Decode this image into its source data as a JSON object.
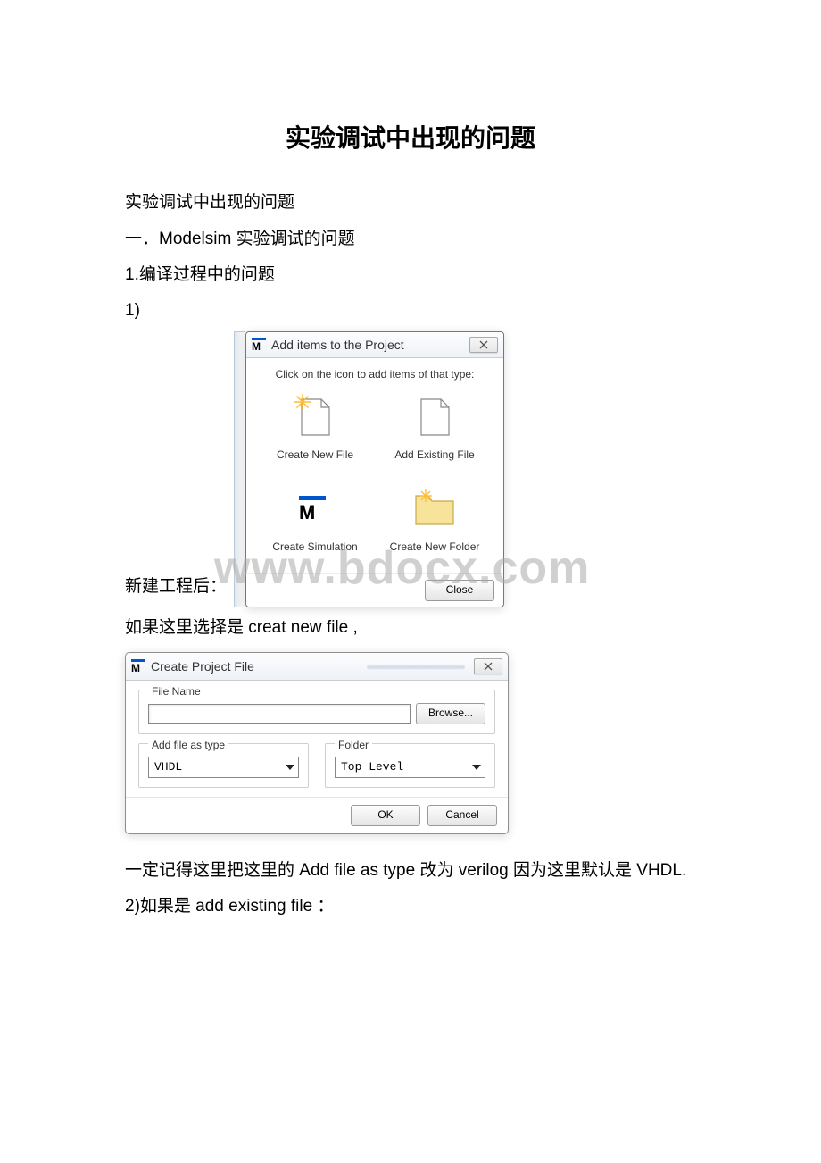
{
  "document": {
    "title": "实验调试中出现的问题",
    "lines": {
      "l1": "实验调试中出现的问题",
      "l2": "一．Modelsim 实验调试的问题",
      "l3": "1.编译过程中的问题",
      "l4": "1)",
      "l5": "新建工程后：",
      "l6": "如果这里选择是 creat new file ,",
      "l7": "一定记得这里把这里的 Add file as type 改为 verilog 因为这里默认是 VHDL.",
      "l8": "2)如果是 add existing file ："
    }
  },
  "watermark": "www.bdocx.com",
  "dlg_add_items": {
    "title": "Add items to the Project",
    "instruction": "Click on the icon to add items of that type:",
    "items": {
      "create_new_file": "Create New File",
      "add_existing_file": "Add Existing File",
      "create_simulation": "Create Simulation",
      "create_new_folder": "Create New Folder"
    },
    "close_label": "Close"
  },
  "dlg_create_project_file": {
    "title": "Create Project File",
    "file_name_legend": "File Name",
    "browse_label": "Browse...",
    "add_type_legend": "Add file as type",
    "add_type_value": "VHDL",
    "folder_legend": "Folder",
    "folder_value": "Top Level",
    "ok_label": "OK",
    "cancel_label": "Cancel"
  }
}
